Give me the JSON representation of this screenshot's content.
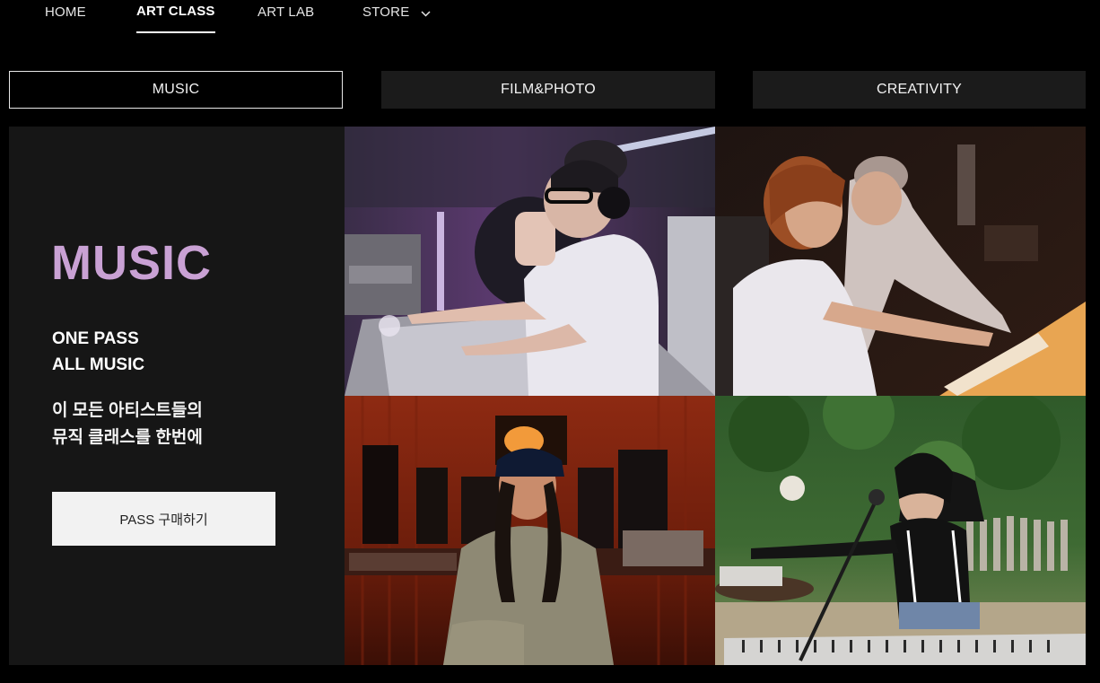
{
  "nav": {
    "items": [
      {
        "label": "HOME"
      },
      {
        "label": "ART CLASS",
        "active": true
      },
      {
        "label": "ART LAB"
      },
      {
        "label": "STORE"
      }
    ]
  },
  "categories": [
    {
      "label": "MUSIC",
      "selected": true
    },
    {
      "label": "FILM&PHOTO"
    },
    {
      "label": "CREATIVITY"
    }
  ],
  "promo": {
    "title": "MUSIC",
    "subtitle_line1": "ONE PASS",
    "subtitle_line2": "ALL MUSIC",
    "desc_line1": "이 모든 아티스트들의",
    "desc_line2": "뮤직 클래스를 한번에",
    "button_label": "PASS 구매하기"
  },
  "colors": {
    "accent_title": "#c9a1d4",
    "tab_bg": "#1b1b1b",
    "panel_bg": "#161616"
  }
}
